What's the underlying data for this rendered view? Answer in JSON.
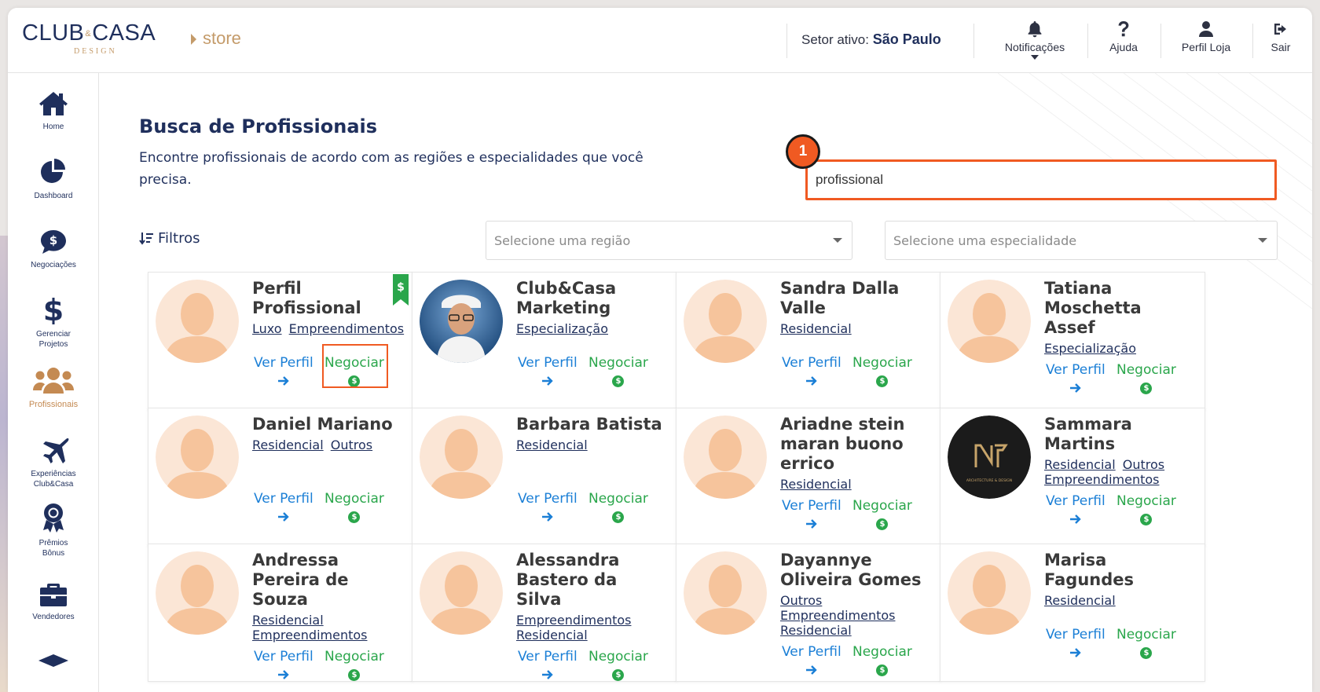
{
  "header": {
    "logo_main_left": "CLUB",
    "logo_amp": "&",
    "logo_main_right": "CASA",
    "logo_sub": "DESIGN",
    "store_label": "store",
    "setor_prefix": "Setor ativo:",
    "setor_value": "São Paulo",
    "buttons": [
      {
        "label": "Notificações",
        "icon": "bell-icon"
      },
      {
        "label": "Ajuda",
        "icon": "question-icon"
      },
      {
        "label": "Perfil Loja",
        "icon": "user-icon"
      },
      {
        "label": "Sair",
        "icon": "logout-icon"
      }
    ]
  },
  "sidebar": {
    "items": [
      {
        "label": "Home",
        "icon": "home-icon"
      },
      {
        "label": "Dashboard",
        "icon": "pie-chart-icon"
      },
      {
        "label": "Negociações",
        "icon": "chat-dollar-icon"
      },
      {
        "label": "Gerenciar Projetos",
        "icon": "dollar-icon"
      },
      {
        "label": "Profissionais",
        "icon": "users-icon",
        "active": true
      },
      {
        "label": "Experiências Club&Casa",
        "icon": "plane-icon"
      },
      {
        "label": "Prêmios Bônus",
        "icon": "award-icon"
      },
      {
        "label": "Vendedores",
        "icon": "briefcase-icon"
      }
    ]
  },
  "main": {
    "title": "Busca de Profissionais",
    "description": "Encontre profissionais de acordo com as regiões e especialidades que você precisa.",
    "search_value": "profissional",
    "marker": "1",
    "filters_label": "Filtros",
    "region_placeholder": "Selecione uma região",
    "specialty_placeholder": "Selecione uma especialidade",
    "ver_perfil": "Ver Perfil",
    "negociar": "Negociar"
  },
  "cards": [
    {
      "name": "Perfil Profissional",
      "specs": [
        "Luxo",
        "Empreendimentos"
      ],
      "avatar": "placeholder",
      "bookmark": true
    },
    {
      "name": "Club&Casa Marketing",
      "specs": [
        "Especialização"
      ],
      "avatar": "photo"
    },
    {
      "name": "Sandra Dalla Valle",
      "specs": [
        "Residencial"
      ],
      "avatar": "placeholder"
    },
    {
      "name": "Tatiana Moschetta Assef",
      "specs": [
        "Especialização"
      ],
      "avatar": "placeholder"
    },
    {
      "name": "Daniel Mariano",
      "specs": [
        "Residencial",
        "Outros"
      ],
      "avatar": "placeholder"
    },
    {
      "name": "Barbara Batista",
      "specs": [
        "Residencial"
      ],
      "avatar": "placeholder"
    },
    {
      "name": "Ariadne stein maran buono errico",
      "specs": [
        "Residencial"
      ],
      "avatar": "placeholder"
    },
    {
      "name": "Sammara Martins",
      "specs": [
        "Residencial",
        "Outros",
        "Empreendimentos"
      ],
      "avatar": "logo",
      "logo_text": "ARCHITECTURE & DESIGN"
    },
    {
      "name": "Andressa Pereira de Souza",
      "specs": [
        "Residencial",
        "Empreendimentos"
      ],
      "avatar": "placeholder"
    },
    {
      "name": "Alessandra Bastero da Silva",
      "specs": [
        "Empreendimentos",
        "Residencial"
      ],
      "avatar": "placeholder"
    },
    {
      "name": "Dayannye Oliveira Gomes",
      "specs": [
        "Outros",
        "Empreendimentos",
        "Residencial"
      ],
      "avatar": "placeholder"
    },
    {
      "name": "Marisa Fagundes",
      "specs": [
        "Residencial"
      ],
      "avatar": "placeholder"
    }
  ],
  "colors": {
    "navy": "#1f2f5c",
    "gold": "#c49b6a",
    "link_blue": "#1b7fd6",
    "green": "#2aa64b",
    "highlight": "#f05a22"
  }
}
